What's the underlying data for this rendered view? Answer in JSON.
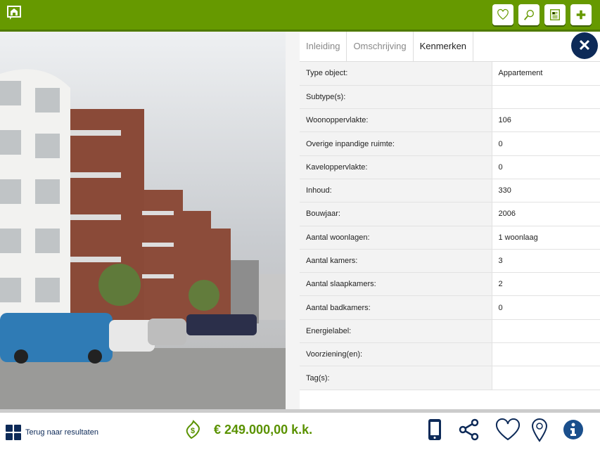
{
  "header": {
    "icons": [
      "home-logo-icon",
      "heart-icon",
      "search-icon",
      "document-icon",
      "plus-icon"
    ]
  },
  "tabs": [
    {
      "label": "Inleiding"
    },
    {
      "label": "Omschrijving"
    },
    {
      "label": "Kenmerken"
    }
  ],
  "close_label": "✕",
  "rows": [
    {
      "label": "Type object:",
      "value": "Appartement"
    },
    {
      "label": "Subtype(s):",
      "value": ""
    },
    {
      "label": "Woonoppervlakte:",
      "value": "106"
    },
    {
      "label": "Overige inpandige ruimte:",
      "value": "0"
    },
    {
      "label": "Kaveloppervlakte:",
      "value": "0"
    },
    {
      "label": "Inhoud:",
      "value": "330"
    },
    {
      "label": "Bouwjaar:",
      "value": "2006"
    },
    {
      "label": "Aantal woonlagen:",
      "value": "1 woonlaag"
    },
    {
      "label": "Aantal kamers:",
      "value": "3"
    },
    {
      "label": "Aantal slaapkamers:",
      "value": "2"
    },
    {
      "label": "Aantal badkamers:",
      "value": "0"
    },
    {
      "label": "Energielabel:",
      "value": ""
    },
    {
      "label": "Voorziening(en):",
      "value": ""
    },
    {
      "label": "Tag(s):",
      "value": ""
    }
  ],
  "footer": {
    "back_label": "Terug naar resultaten",
    "price": "€ 249.000,00 k.k."
  },
  "colors": {
    "green": "#669900",
    "navy": "#0d2a58",
    "price": "#5a9200"
  }
}
